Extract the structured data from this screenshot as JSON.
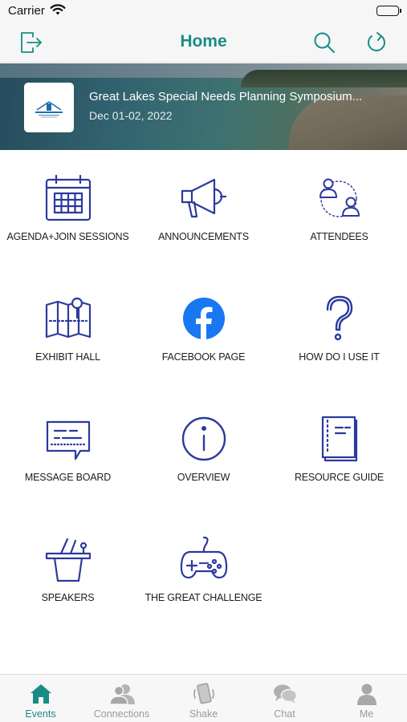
{
  "status": {
    "carrier": "Carrier"
  },
  "header": {
    "title": "Home",
    "icons": [
      "logout-icon",
      "search-icon",
      "refresh-icon"
    ]
  },
  "event": {
    "title": "Great Lakes Special Needs Planning Symposium...",
    "dates": "Dec 01-02, 2022"
  },
  "menu": [
    {
      "label": "AGENDA+JOIN SESSIONS",
      "icon": "calendar-icon"
    },
    {
      "label": "ANNOUNCEMENTS",
      "icon": "megaphone-icon"
    },
    {
      "label": "ATTENDEES",
      "icon": "attendees-icon"
    },
    {
      "label": "EXHIBIT HALL",
      "icon": "map-icon"
    },
    {
      "label": "FACEBOOK PAGE",
      "icon": "facebook-icon"
    },
    {
      "label": "HOW DO I USE IT",
      "icon": "question-icon"
    },
    {
      "label": "MESSAGE BOARD",
      "icon": "message-icon"
    },
    {
      "label": "OVERVIEW",
      "icon": "info-icon"
    },
    {
      "label": "RESOURCE GUIDE",
      "icon": "book-icon"
    },
    {
      "label": "SPEAKERS",
      "icon": "podium-icon"
    },
    {
      "label": "THE GREAT CHALLENGE",
      "icon": "gamepad-icon"
    }
  ],
  "tabs": [
    {
      "label": "Events",
      "icon": "home-icon",
      "active": true
    },
    {
      "label": "Connections",
      "icon": "connections-icon",
      "active": false
    },
    {
      "label": "Shake",
      "icon": "shake-icon",
      "active": false
    },
    {
      "label": "Chat",
      "icon": "chat-icon",
      "active": false
    },
    {
      "label": "Me",
      "icon": "person-icon",
      "active": false
    }
  ],
  "colors": {
    "accent": "#1a8c86",
    "icon_blue": "#2c3a9e",
    "facebook": "#1877f2",
    "tab_inactive": "#9a9a9a"
  }
}
